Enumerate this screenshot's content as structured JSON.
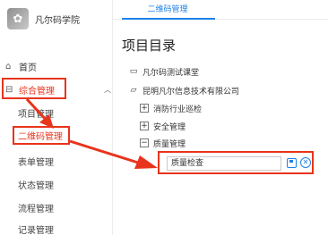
{
  "brand": {
    "name": "凡尔码学院"
  },
  "sidebar": {
    "home": "首页",
    "group": "综合管理",
    "items": [
      "项目管理",
      "二维码管理",
      "表单管理",
      "状态管理",
      "流程管理",
      "记录管理"
    ]
  },
  "tabs": [
    {
      "label": "二维码管理"
    }
  ],
  "main": {
    "title": "项目目录",
    "tree": [
      {
        "label": "凡尔码测试课堂"
      },
      {
        "label": "昆明凡尔信息技术有限公司"
      },
      {
        "label": "消防行业巡检"
      },
      {
        "label": "安全管理"
      },
      {
        "label": "质量管理"
      }
    ],
    "edit_value": "质量检查"
  },
  "colors": {
    "accent": "#1e82e6",
    "highlight": "#e8341c"
  }
}
